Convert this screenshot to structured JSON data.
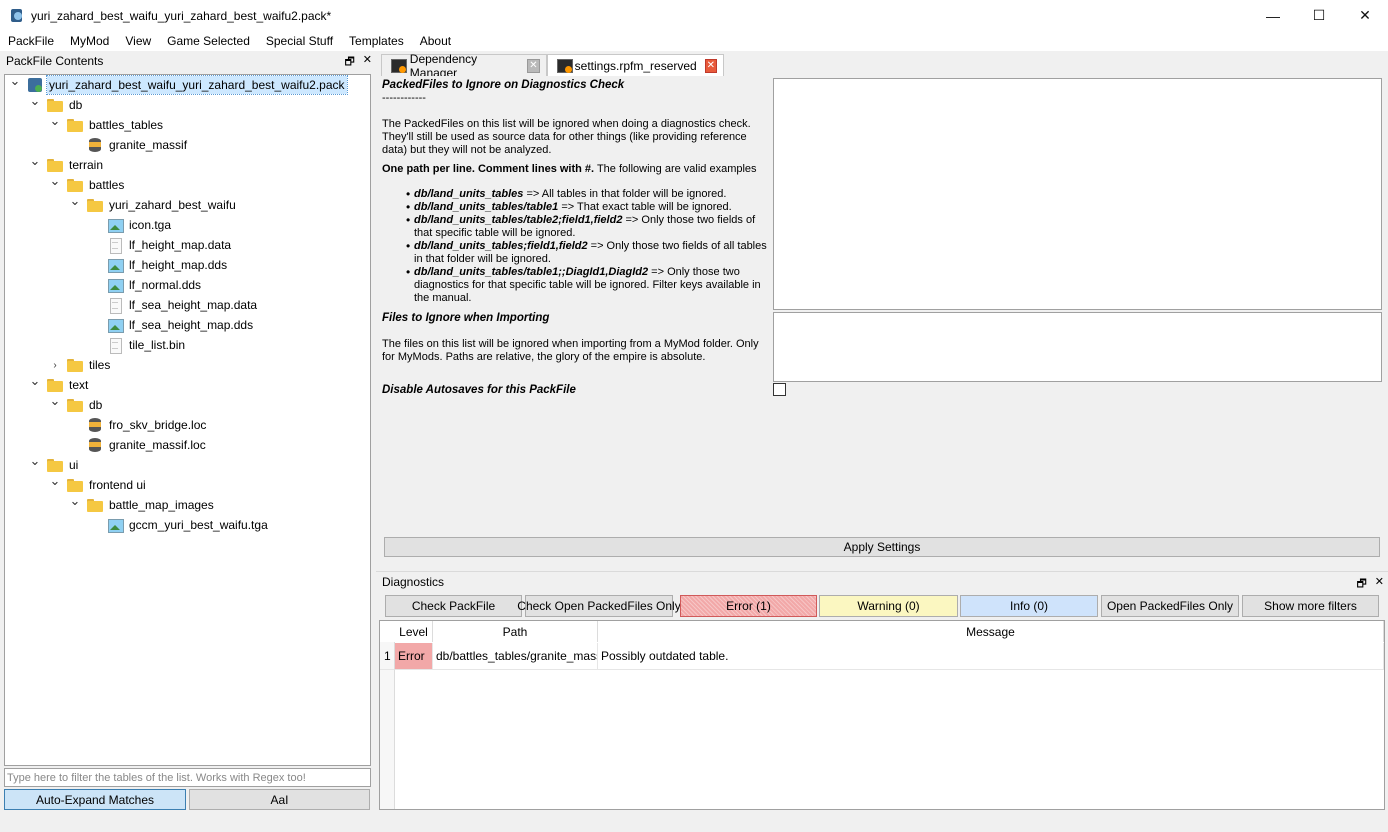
{
  "window": {
    "title": "yuri_zahard_best_waifu_yuri_zahard_best_waifu2.pack*",
    "minimize": "—",
    "maximize": "☐",
    "close": "✕"
  },
  "menu": [
    "PackFile",
    "MyMod",
    "View",
    "Game Selected",
    "Special Stuff",
    "Templates",
    "About"
  ],
  "left_panel": {
    "title": "PackFile Contents",
    "tree": [
      {
        "label": "yuri_zahard_best_waifu_yuri_zahard_best_waifu2.pack",
        "depth": 0,
        "icon": "pack",
        "expander": "open",
        "selected": true
      },
      {
        "label": "db",
        "depth": 1,
        "icon": "folder",
        "expander": "open"
      },
      {
        "label": "battles_tables",
        "depth": 2,
        "icon": "folder",
        "expander": "open"
      },
      {
        "label": "granite_massif",
        "depth": 3,
        "icon": "db",
        "expander": "none"
      },
      {
        "label": "terrain",
        "depth": 1,
        "icon": "folder",
        "expander": "open"
      },
      {
        "label": "battles",
        "depth": 2,
        "icon": "folder",
        "expander": "open"
      },
      {
        "label": "yuri_zahard_best_waifu",
        "depth": 3,
        "icon": "folder",
        "expander": "open"
      },
      {
        "label": "icon.tga",
        "depth": 4,
        "icon": "image",
        "expander": "none"
      },
      {
        "label": "lf_height_map.data",
        "depth": 4,
        "icon": "file",
        "expander": "none"
      },
      {
        "label": "lf_height_map.dds",
        "depth": 4,
        "icon": "image",
        "expander": "none"
      },
      {
        "label": "lf_normal.dds",
        "depth": 4,
        "icon": "image",
        "expander": "none"
      },
      {
        "label": "lf_sea_height_map.data",
        "depth": 4,
        "icon": "file",
        "expander": "none"
      },
      {
        "label": "lf_sea_height_map.dds",
        "depth": 4,
        "icon": "image",
        "expander": "none"
      },
      {
        "label": "tile_list.bin",
        "depth": 4,
        "icon": "file",
        "expander": "none"
      },
      {
        "label": "tiles",
        "depth": 2,
        "icon": "folder",
        "expander": "closed"
      },
      {
        "label": "text",
        "depth": 1,
        "icon": "folder",
        "expander": "open"
      },
      {
        "label": "db",
        "depth": 2,
        "icon": "folder",
        "expander": "open"
      },
      {
        "label": "fro_skv_bridge.loc",
        "depth": 3,
        "icon": "db",
        "expander": "none"
      },
      {
        "label": "granite_massif.loc",
        "depth": 3,
        "icon": "db",
        "expander": "none"
      },
      {
        "label": "ui",
        "depth": 1,
        "icon": "folder",
        "expander": "open"
      },
      {
        "label": "frontend ui",
        "depth": 2,
        "icon": "folder",
        "expander": "open"
      },
      {
        "label": "battle_map_images",
        "depth": 3,
        "icon": "folder",
        "expander": "open"
      },
      {
        "label": "gccm_yuri_best_waifu.tga",
        "depth": 4,
        "icon": "image",
        "expander": "none"
      }
    ],
    "filter_placeholder": "Type here to filter the tables of the list. Works with Regex too!",
    "auto_expand_label": "Auto-Expand Matches",
    "case_label": "AaI"
  },
  "tabs": [
    {
      "label": "Dependency Manager",
      "active": false
    },
    {
      "label": "settings.rpfm_reserved",
      "active": true
    }
  ],
  "settings": {
    "ignore_diag": {
      "title": "PackedFiles to Ignore on Diagnostics Check",
      "separator": "------------",
      "desc": "The PackedFiles on this list will be ignored when doing a diagnostics check. They'll still be used as source data for other things (like providing reference data) but they will not be analyzed.",
      "one_path_bold": "One path per line. Comment lines with #.",
      "one_path_rest": " The following are valid examples",
      "examples": [
        {
          "code": "db/land_units_tables",
          "text": " => All tables in that folder will be ignored."
        },
        {
          "code": "db/land_units_tables/table1",
          "text": " => That exact table will be ignored."
        },
        {
          "code": "db/land_units_tables/table2;field1,field2",
          "text": " => Only those two fields of that specific table will be ignored."
        },
        {
          "code": "db/land_units_tables;field1,field2",
          "text": " => Only those two fields of all tables in that folder will be ignored."
        },
        {
          "code": "db/land_units_tables/table1;;DiagId1,DiagId2",
          "text": " => Only those two diagnostics for that specific table will be ignored. Filter keys available in the manual."
        }
      ]
    },
    "ignore_import": {
      "title": "Files to Ignore when Importing",
      "desc": "The files on this list will be ignored when importing from a MyMod folder. Only for MyMods. Paths are relative, the glory of the empire is absolute."
    },
    "disable_autosaves": {
      "title": "Disable Autosaves for this PackFile",
      "checked": false
    },
    "apply_label": "Apply Settings"
  },
  "diagnostics": {
    "title": "Diagnostics",
    "buttons": {
      "check_packfile": "Check PackFile",
      "check_open": "Check Open PackedFiles Only",
      "error": "Error (1)",
      "warning": "Warning (0)",
      "info": "Info (0)",
      "open_only": "Open PackedFiles Only",
      "more_filters": "Show more filters"
    },
    "colors": {
      "error": "#f2a8a8",
      "warning": "#fbf7c1",
      "info": "#cfe3fb"
    },
    "columns": [
      "Level",
      "Path",
      "Message"
    ],
    "rows": [
      {
        "num": "1",
        "level": "Error",
        "path": "db/battles_tables/granite_massif",
        "message": "Possibly outdated table."
      }
    ]
  }
}
